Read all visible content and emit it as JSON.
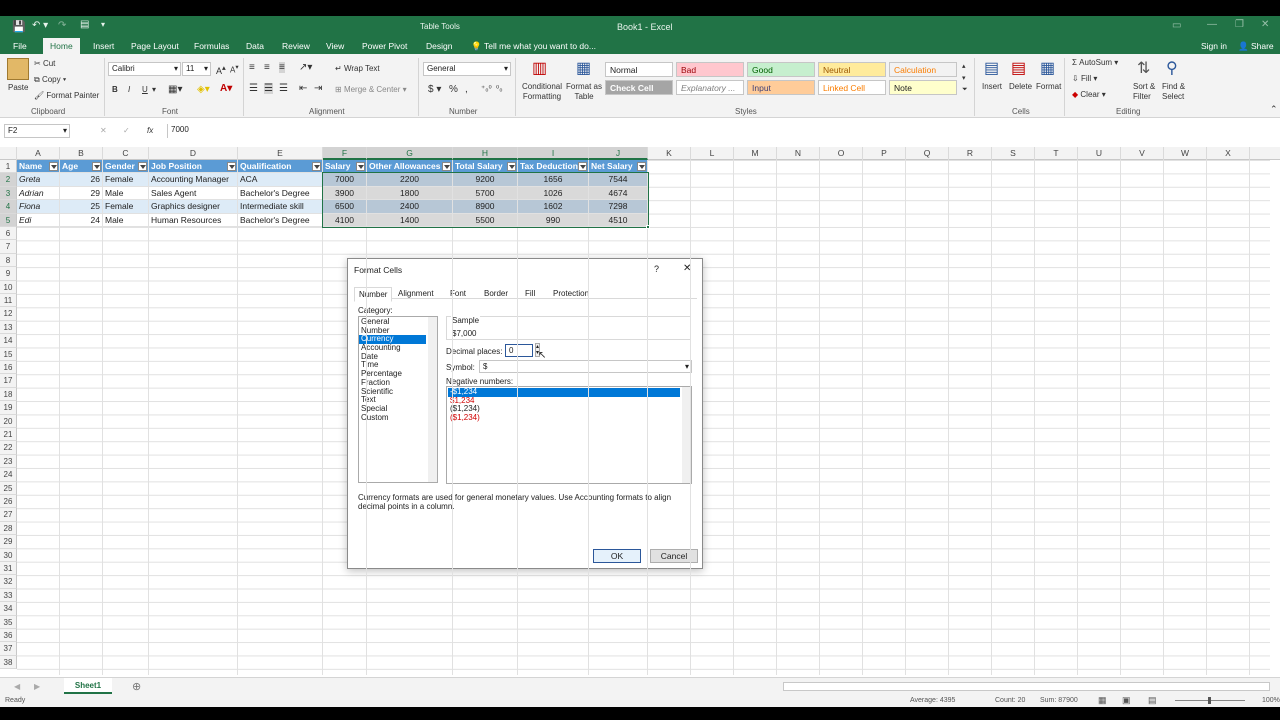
{
  "window": {
    "title": "Book1 - Excel",
    "context_tab": "Table Tools"
  },
  "menu": {
    "tabs": [
      "File",
      "Home",
      "Insert",
      "Page Layout",
      "Formulas",
      "Data",
      "Review",
      "View",
      "Power Pivot",
      "Design"
    ],
    "tell_me": "Tell me what you want to do...",
    "sign_in": "Sign in",
    "share": "Share"
  },
  "ribbon": {
    "clipboard": {
      "paste": "Paste",
      "cut": "Cut",
      "copy": "Copy",
      "format_painter": "Format Painter",
      "label": "Clipboard"
    },
    "font": {
      "name": "Calibri",
      "size": "11",
      "label": "Font",
      "bold": "B",
      "italic": "I",
      "underline": "U"
    },
    "alignment": {
      "wrap": "Wrap Text",
      "merge": "Merge & Center",
      "label": "Alignment"
    },
    "number": {
      "format": "General",
      "currency": "$",
      "percent": "%",
      "comma": ",",
      "label": "Number"
    },
    "styles": {
      "conditional": "Conditional Formatting",
      "format_table": "Format as Table",
      "label": "Styles",
      "cells": [
        {
          "name": "Normal",
          "bg": "#ffffff",
          "fg": "#222222"
        },
        {
          "name": "Bad",
          "bg": "#ffc7ce",
          "fg": "#9c0006"
        },
        {
          "name": "Good",
          "bg": "#c6efce",
          "fg": "#006100"
        },
        {
          "name": "Neutral",
          "bg": "#ffeb9c",
          "fg": "#9c5700"
        },
        {
          "name": "Calculation",
          "bg": "#f2f2f2",
          "fg": "#fa7d00"
        },
        {
          "name": "Check Cell",
          "bg": "#a5a5a5",
          "fg": "#ffffff"
        },
        {
          "name": "Explanatory ...",
          "bg": "#ffffff",
          "fg": "#7f7f7f"
        },
        {
          "name": "Input",
          "bg": "#ffcc99",
          "fg": "#3f3f76"
        },
        {
          "name": "Linked Cell",
          "bg": "#ffffff",
          "fg": "#fa7d00"
        },
        {
          "name": "Note",
          "bg": "#ffffcc",
          "fg": "#222222"
        }
      ]
    },
    "cells": {
      "insert": "Insert",
      "delete": "Delete",
      "format": "Format",
      "label": "Cells"
    },
    "editing": {
      "autosum": "AutoSum",
      "fill": "Fill",
      "clear": "Clear",
      "sort": "Sort & Filter",
      "find": "Find & Select",
      "label": "Editing"
    }
  },
  "formula_bar": {
    "name_box": "F2",
    "value": "7000",
    "cancel": "✕",
    "enter": "✓",
    "fx": "fx"
  },
  "columns": [
    "A",
    "B",
    "C",
    "D",
    "E",
    "F",
    "G",
    "H",
    "I",
    "J",
    "K",
    "L",
    "M",
    "N",
    "O",
    "P",
    "Q",
    "R",
    "S",
    "T",
    "U",
    "V",
    "W",
    "X",
    "Y"
  ],
  "rows": [
    "1",
    "2",
    "3",
    "4",
    "5",
    "6",
    "7",
    "8",
    "9",
    "10",
    "11",
    "12",
    "13",
    "14",
    "15",
    "16",
    "17",
    "18",
    "19",
    "20",
    "21",
    "22",
    "23",
    "24",
    "25",
    "26",
    "27",
    "28",
    "29",
    "30",
    "31",
    "32",
    "33",
    "34",
    "35",
    "36",
    "37",
    "38"
  ],
  "table": {
    "headers": [
      "Name",
      "Age",
      "Gender",
      "Job Position",
      "Qualification",
      "Salary",
      "Other Allowances",
      "Total Salary",
      "Tax Deduction",
      "Net Salary"
    ],
    "rows": [
      [
        "Greta",
        "26",
        "Female",
        "Accounting Manager",
        "ACA",
        "7000",
        "2200",
        "9200",
        "1656",
        "7544"
      ],
      [
        "Adrian",
        "29",
        "Male",
        "Sales Agent",
        "Bachelor's Degree",
        "3900",
        "1800",
        "5700",
        "1026",
        "4674"
      ],
      [
        "Fiona",
        "25",
        "Female",
        "Graphics designer",
        "Intermediate skill",
        "6500",
        "2400",
        "8900",
        "1602",
        "7298"
      ],
      [
        "Edi",
        "24",
        "Male",
        "Human Resources",
        "Bachelor's Degree",
        "4100",
        "1400",
        "5500",
        "990",
        "4510"
      ]
    ]
  },
  "dialog": {
    "title": "Format Cells",
    "help": "?",
    "close": "✕",
    "tabs": [
      "Number",
      "Alignment",
      "Font",
      "Border",
      "Fill",
      "Protection"
    ],
    "category_label": "Category:",
    "categories": [
      "General",
      "Number",
      "Currency",
      "Accounting",
      "Date",
      "Time",
      "Percentage",
      "Fraction",
      "Scientific",
      "Text",
      "Special",
      "Custom"
    ],
    "selected_category": "Currency",
    "sample_label": "Sample",
    "sample_value": "$7,000",
    "decimal_label": "Decimal places:",
    "decimal_value": "0",
    "symbol_label": "Symbol:",
    "symbol_value": "$",
    "negative_label": "Negative numbers:",
    "negative_options": [
      {
        "text": "-$1,234",
        "color": "#ffffff",
        "selected": true
      },
      {
        "text": "$1,234",
        "color": "#d00000",
        "selected": false
      },
      {
        "text": "($1,234)",
        "color": "#222222",
        "selected": false
      },
      {
        "text": "($1,234)",
        "color": "#d00000",
        "selected": false
      }
    ],
    "description": "Currency formats are used for general monetary values.  Use Accounting formats to align decimal points in a column.",
    "ok": "OK",
    "cancel": "Cancel"
  },
  "sheet_tab": "Sheet1",
  "status": {
    "ready": "Ready",
    "average": "Average: 4395",
    "count": "Count: 20",
    "sum": "Sum: 87900",
    "zoom": "100%"
  }
}
